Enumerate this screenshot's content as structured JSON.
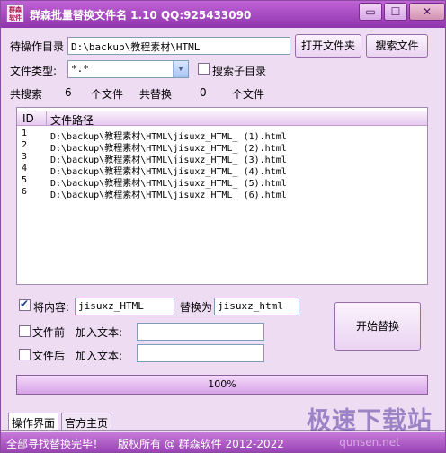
{
  "window": {
    "logo_text": "群森\n软件",
    "title": "群森批量替换文件名  1.10 QQ:925433090",
    "controls": {
      "minimize": "▭",
      "maximize": "☐",
      "close": "✕"
    }
  },
  "path_row": {
    "label": "待操作目录",
    "value": "D:\\backup\\教程素材\\HTML",
    "open_button": "打开文件夹",
    "search_button": "搜索文件"
  },
  "type_row": {
    "label": "文件类型:",
    "value": "*.*",
    "subdir_label": "搜索子目录",
    "subdir_checked": false
  },
  "stats": {
    "searched_label": "共搜索",
    "searched_count": "6",
    "searched_unit": "个文件",
    "replaced_label": "共替换",
    "replaced_count": "0",
    "replaced_unit": "个文件"
  },
  "file_list": {
    "columns": [
      "ID",
      "文件路径"
    ],
    "rows": [
      {
        "id": "1",
        "path": "D:\\backup\\教程素材\\HTML\\jisuxz_HTML_ (1).html"
      },
      {
        "id": "2",
        "path": "D:\\backup\\教程素材\\HTML\\jisuxz_HTML_ (2).html"
      },
      {
        "id": "3",
        "path": "D:\\backup\\教程素材\\HTML\\jisuxz_HTML_ (3).html"
      },
      {
        "id": "4",
        "path": "D:\\backup\\教程素材\\HTML\\jisuxz_HTML_ (4).html"
      },
      {
        "id": "5",
        "path": "D:\\backup\\教程素材\\HTML\\jisuxz_HTML_ (5).html"
      },
      {
        "id": "6",
        "path": "D:\\backup\\教程素材\\HTML\\jisuxz_HTML_ (6).html"
      }
    ]
  },
  "replace": {
    "content_checked": true,
    "content_label": "将内容:",
    "content_value": "jisuxz_HTML",
    "replace_with_label": "替换为",
    "replace_with_value": "jisuxz_html",
    "prefix_checked": false,
    "prefix_label": "文件前",
    "prefix_add_label": "加入文本:",
    "prefix_value": "",
    "suffix_checked": false,
    "suffix_label": "文件后",
    "suffix_add_label": "加入文本:",
    "suffix_value": "",
    "start_button": "开始替换"
  },
  "progress": {
    "value": 1.0,
    "text": "100%"
  },
  "tabs": [
    {
      "label": "操作界面",
      "active": true
    },
    {
      "label": "官方主页",
      "active": false
    }
  ],
  "status": {
    "message": "全部寻找替换完毕！",
    "copyright": "版权所有 @ 群森软件 2012-2022"
  },
  "watermark": {
    "main": "极速下载站",
    "sub": "qunsen.net"
  }
}
